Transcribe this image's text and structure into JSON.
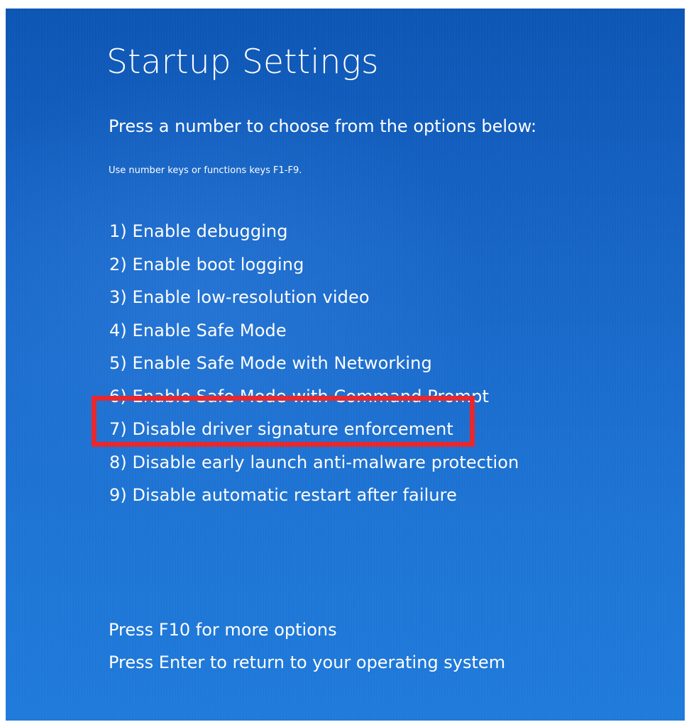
{
  "screen": {
    "title": "Startup Settings",
    "subtitle": "Press a number to choose from the options below:",
    "hint": "Use number keys or functions keys F1-F9."
  },
  "options": [
    {
      "label": "1) Enable debugging"
    },
    {
      "label": "2) Enable boot logging"
    },
    {
      "label": "3) Enable low-resolution video"
    },
    {
      "label": "4) Enable Safe Mode"
    },
    {
      "label": "5) Enable Safe Mode with Networking"
    },
    {
      "label": "6) Enable Safe Mode with Command Prompt"
    },
    {
      "label": "7) Disable driver signature enforcement"
    },
    {
      "label": "8) Disable early launch anti-malware protection"
    },
    {
      "label": "9) Disable automatic restart after failure"
    }
  ],
  "highlighted_option_index": 6,
  "footer": {
    "more_options": "Press F10 for more options",
    "return": "Press Enter to return to your operating system"
  },
  "colors": {
    "background": "#1a6ccd",
    "text": "#ffffff",
    "highlight_border": "#e8272e"
  }
}
